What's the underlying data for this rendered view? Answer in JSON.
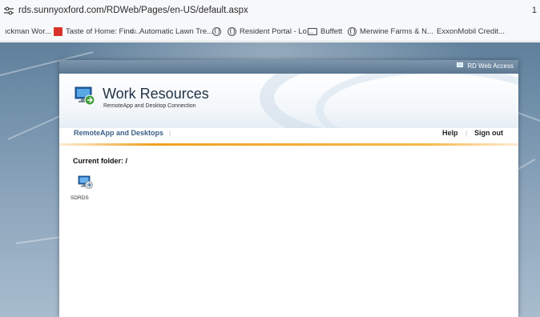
{
  "browser": {
    "url": "rds.sunnyoxford.com/RDWeb/Pages/en-US/default.aspx",
    "edge_char": "1",
    "bookmarks": [
      {
        "label": "ıckman Wor...",
        "icon": "none"
      },
      {
        "label": "Taste of Home: Find...",
        "icon": "taste-of-home-icon"
      },
      {
        "label": "Automatic Lawn Tre...",
        "icon": "link-icon"
      },
      {
        "label": "",
        "icon": "globe-icon"
      },
      {
        "label": "Resident Portal - Lo...",
        "icon": "globe-icon"
      },
      {
        "label": "Buffett",
        "icon": "folder-icon"
      },
      {
        "label": "Merwine Farms & N...",
        "icon": "globe-icon"
      },
      {
        "label": "ExxonMobil Credit...",
        "icon": "none"
      }
    ]
  },
  "rdweb": {
    "top_link": "RD Web Access",
    "title": "Work Resources",
    "subtitle": "RemoteApp and Desktop Connection",
    "nav": {
      "remoteapp": "RemoteApp and Desktops",
      "help": "Help",
      "signout": "Sign out"
    },
    "current_folder": "Current folder: /",
    "apps": [
      {
        "name": "SDRDS",
        "icon": "remote-desktop-icon"
      }
    ]
  },
  "colors": {
    "nav_link": "#3a5f86",
    "accent_rule": "#f0a020",
    "backdrop": "#7694ae"
  }
}
